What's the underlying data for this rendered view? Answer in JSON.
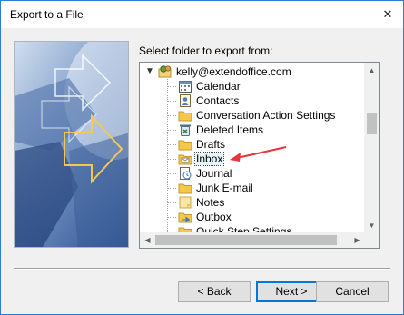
{
  "window": {
    "title": "Export to a File",
    "close_glyph": "✕"
  },
  "prompt": "Select folder to export from:",
  "tree": {
    "root": {
      "label": "kelly@extendoffice.com",
      "icon": "mailbox-icon",
      "expanded": true
    },
    "items": [
      {
        "label": "Calendar",
        "icon": "calendar-icon"
      },
      {
        "label": "Contacts",
        "icon": "contacts-icon"
      },
      {
        "label": "Conversation Action Settings",
        "icon": "folder-icon"
      },
      {
        "label": "Deleted Items",
        "icon": "trash-icon"
      },
      {
        "label": "Drafts",
        "icon": "folder-icon"
      },
      {
        "label": "Inbox",
        "icon": "inbox-icon",
        "selected": true
      },
      {
        "label": "Journal",
        "icon": "journal-icon"
      },
      {
        "label": "Junk E-mail",
        "icon": "folder-icon"
      },
      {
        "label": "Notes",
        "icon": "notes-icon"
      },
      {
        "label": "Outbox",
        "icon": "outbox-icon"
      },
      {
        "label": "Quick Step Settings",
        "icon": "folder-icon"
      }
    ]
  },
  "buttons": {
    "back": "< Back",
    "next": "Next >",
    "cancel": "Cancel"
  },
  "colors": {
    "annotation_arrow": "#e5353d",
    "accent": "#0078d7",
    "folder": "#f5c84c"
  }
}
